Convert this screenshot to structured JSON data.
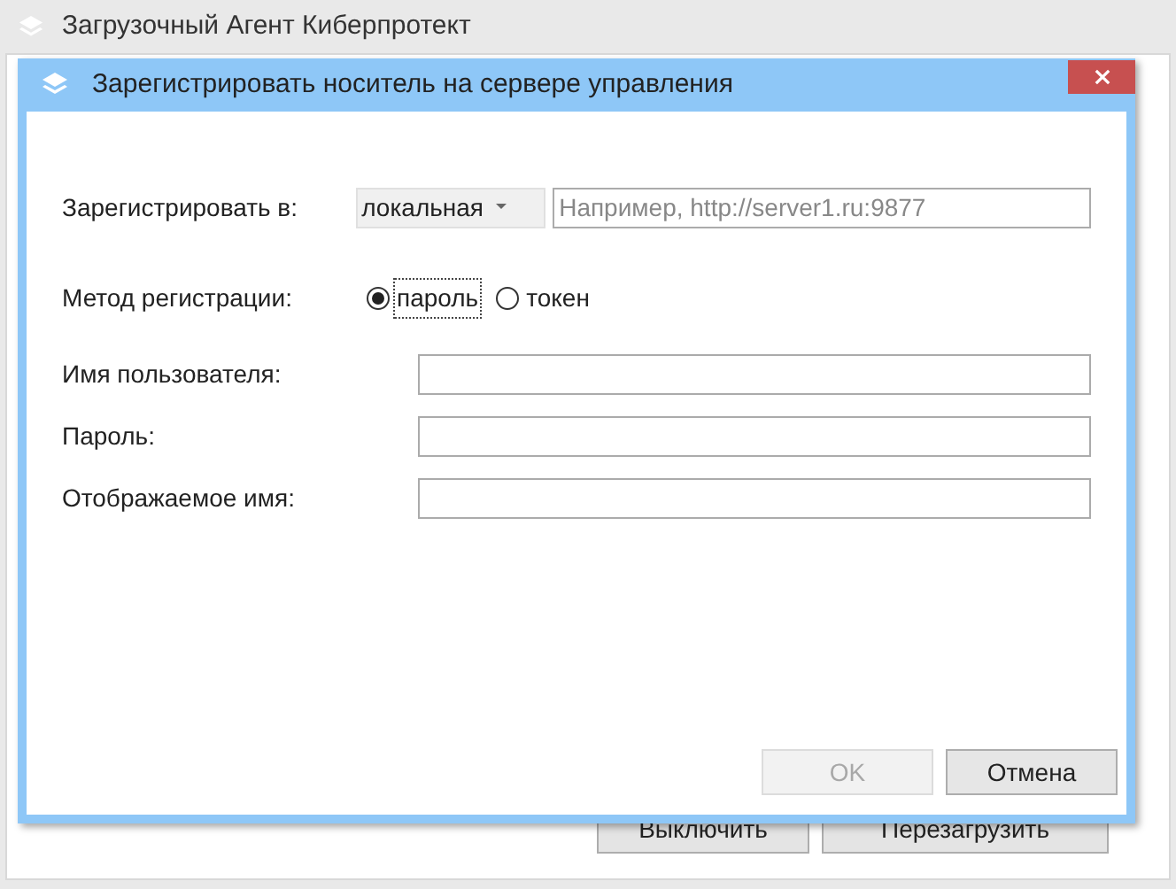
{
  "window": {
    "title": "Загрузочный Агент Киберпротект"
  },
  "background_buttons": [
    "Выключить",
    "Перезагрузить"
  ],
  "dialog": {
    "title": "Зарегистрировать носитель на сервере управления",
    "register_in": {
      "label": "Зарегистрировать в:",
      "dropdown_value": "локальная",
      "address_placeholder": "Например, http://server1.ru:9877"
    },
    "method": {
      "label": "Метод регистрации:",
      "options": [
        {
          "label": "пароль",
          "selected": true
        },
        {
          "label": "токен",
          "selected": false
        }
      ]
    },
    "fields": [
      {
        "label": "Имя пользователя:"
      },
      {
        "label": "Пароль:"
      },
      {
        "label": "Отображаемое имя:"
      }
    ],
    "buttons": [
      {
        "label": "OK",
        "disabled": true
      },
      {
        "label": "Отмена",
        "disabled": false
      }
    ]
  }
}
